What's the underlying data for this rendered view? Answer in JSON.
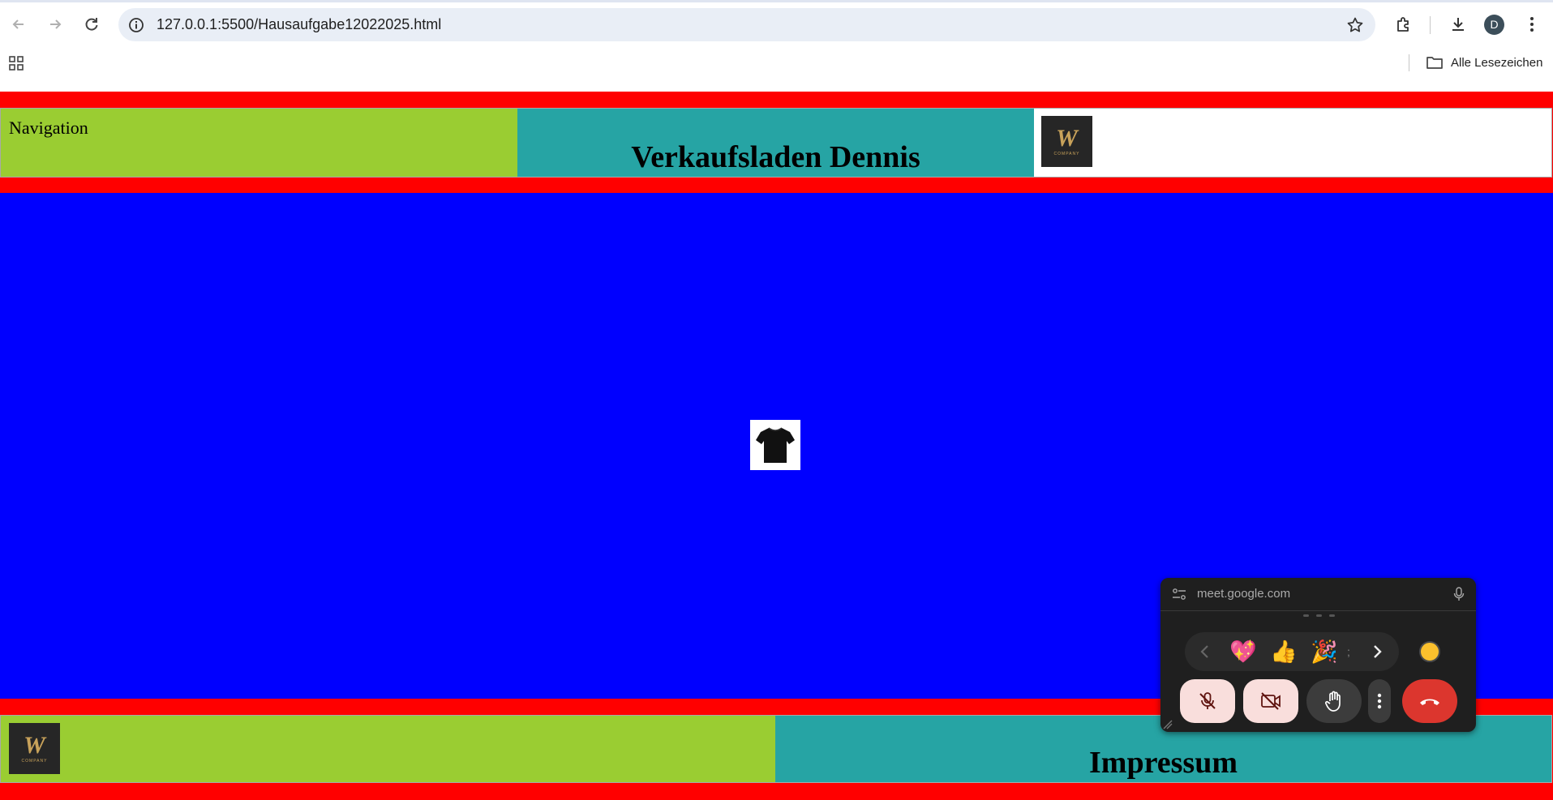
{
  "browser": {
    "url": "127.0.0.1:5500/Hausaufgabe12022025.html",
    "profile_initial": "D",
    "bookmarks_label": "Alle Lesezeichen"
  },
  "page": {
    "navigation_label": "Navigation",
    "title": "Verkaufsladen Dennis",
    "logo_word": "COMPANY",
    "footer_title": "Impressum",
    "colors": {
      "header_bg": "#ff0000",
      "nav_bg": "#9acd32",
      "title_bg": "#26a4a4",
      "main_bg": "#0000ff"
    }
  },
  "meet": {
    "domain": "meet.google.com",
    "reactions": [
      "💖",
      "👍",
      "🎉"
    ],
    "reaction_icons": [
      "sparkling-heart",
      "thumbs-up",
      "party-popper"
    ],
    "controls": [
      "mic-off",
      "camera-off",
      "raise-hand",
      "more-options",
      "leave-call"
    ]
  }
}
